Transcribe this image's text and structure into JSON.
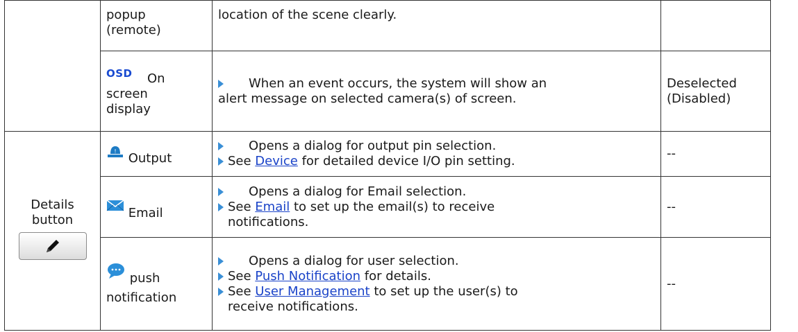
{
  "rows": {
    "popup": {
      "name_line1": "popup",
      "name_line2": "(remote)",
      "description": "location of the scene clearly."
    },
    "osd": {
      "icon_text": "OSD",
      "name_suffix": "On",
      "name_line2": "screen",
      "name_line3": "display",
      "description_line1": "When an event occurs, the system will show an",
      "description_line2": "alert message on selected camera(s) of screen.",
      "default_line1": "Deselected",
      "default_line2": "(Disabled)"
    },
    "details": {
      "label_line1": "Details",
      "label_line2": "button",
      "button_icon": "pencil-icon"
    },
    "output": {
      "icon": "siren-light-icon",
      "name": "Output",
      "bullet1": "Opens a dialog for output pin selection.",
      "bullet2_pre": "See ",
      "bullet2_link": "Device",
      "bullet2_post": " for detailed device I/O pin setting.",
      "default": "--"
    },
    "email": {
      "icon": "envelope-icon",
      "name": "Email",
      "bullet1": "Opens a dialog for Email selection.",
      "bullet2_pre": "See ",
      "bullet2_link": "Email",
      "bullet2_post": " to set up the email(s) to receive",
      "bullet2_cont": "notifications.",
      "default": "--"
    },
    "push": {
      "icon": "chat-bubble-icon",
      "name_line1": "push",
      "name_line2": "notification",
      "bullet1": "Opens a dialog for user selection.",
      "bullet2_pre": "See ",
      "bullet2_link": "Push Notification",
      "bullet2_post": " for details.",
      "bullet3_pre": "See ",
      "bullet3_link": "User Management",
      "bullet3_post": " to set up the user(s) to",
      "bullet3_cont": "receive notifications.",
      "default": "--"
    }
  },
  "colors": {
    "link": "#1a43c8",
    "bullet": "#3a8fd6",
    "border": "#333333"
  }
}
